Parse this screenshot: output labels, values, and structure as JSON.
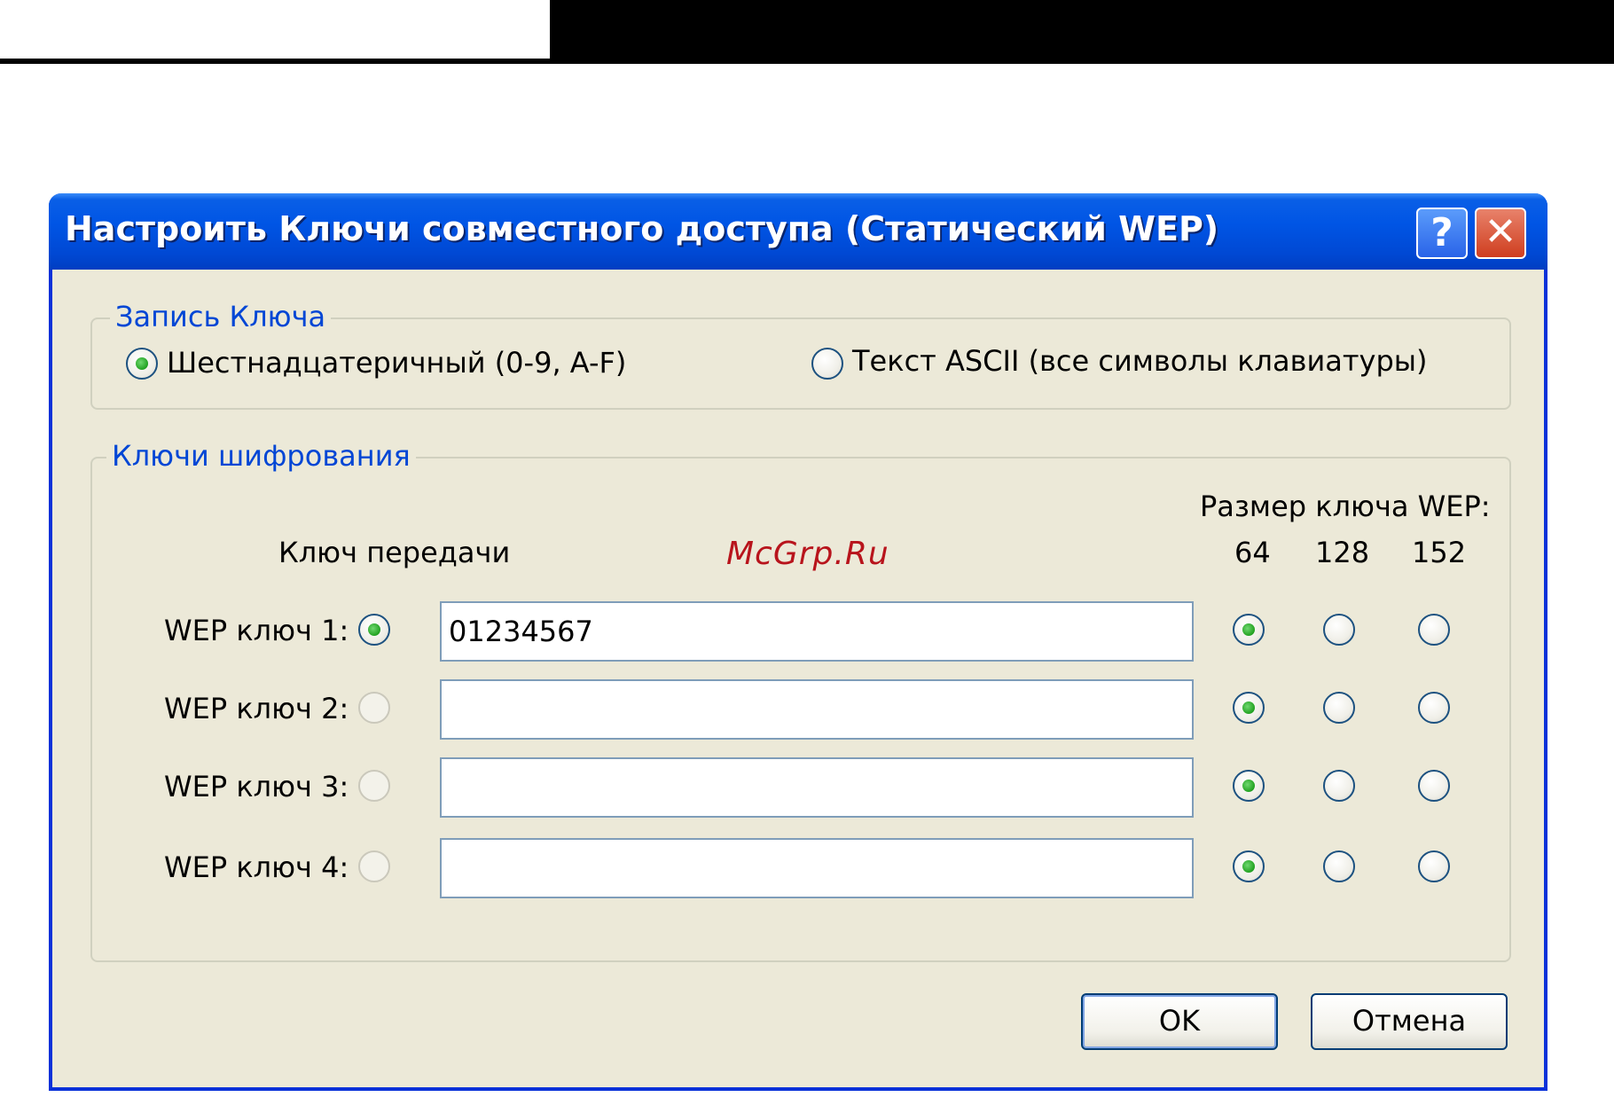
{
  "window": {
    "title": "Настроить Ключи совместного доступа (Статический WEP)",
    "help_glyph": "?",
    "close_glyph": "✕",
    "titlebar_color": "#0055e5"
  },
  "key_entry": {
    "legend": "Запись Ключа",
    "options": [
      {
        "label": "Шестнадцатеричный (0-9, A-F)",
        "selected": true
      },
      {
        "label": "Текст ASCII (все символы клавиатуры)",
        "selected": false
      }
    ]
  },
  "encryption_keys": {
    "legend": "Ключи шифрования",
    "transmit_key_header": "Ключ передачи",
    "key_size_header": "Размер ключа WEP:",
    "key_sizes": [
      "64",
      "128",
      "152"
    ],
    "keys": [
      {
        "label": "WEP ключ 1:",
        "value": "01234567",
        "transmit": true,
        "size": "64"
      },
      {
        "label": "WEP ключ 2:",
        "value": "",
        "transmit": false,
        "size": "64"
      },
      {
        "label": "WEP ключ 3:",
        "value": "",
        "transmit": false,
        "size": "64"
      },
      {
        "label": "WEP ключ 4:",
        "value": "",
        "transmit": false,
        "size": "64"
      }
    ]
  },
  "buttons": {
    "ok": "OK",
    "cancel": "Отмена"
  },
  "watermark": "McGrp.Ru",
  "colors": {
    "dialog_bg": "#ece9d8",
    "legend_text": "#0046d5",
    "radio_dot": "#21a121"
  }
}
